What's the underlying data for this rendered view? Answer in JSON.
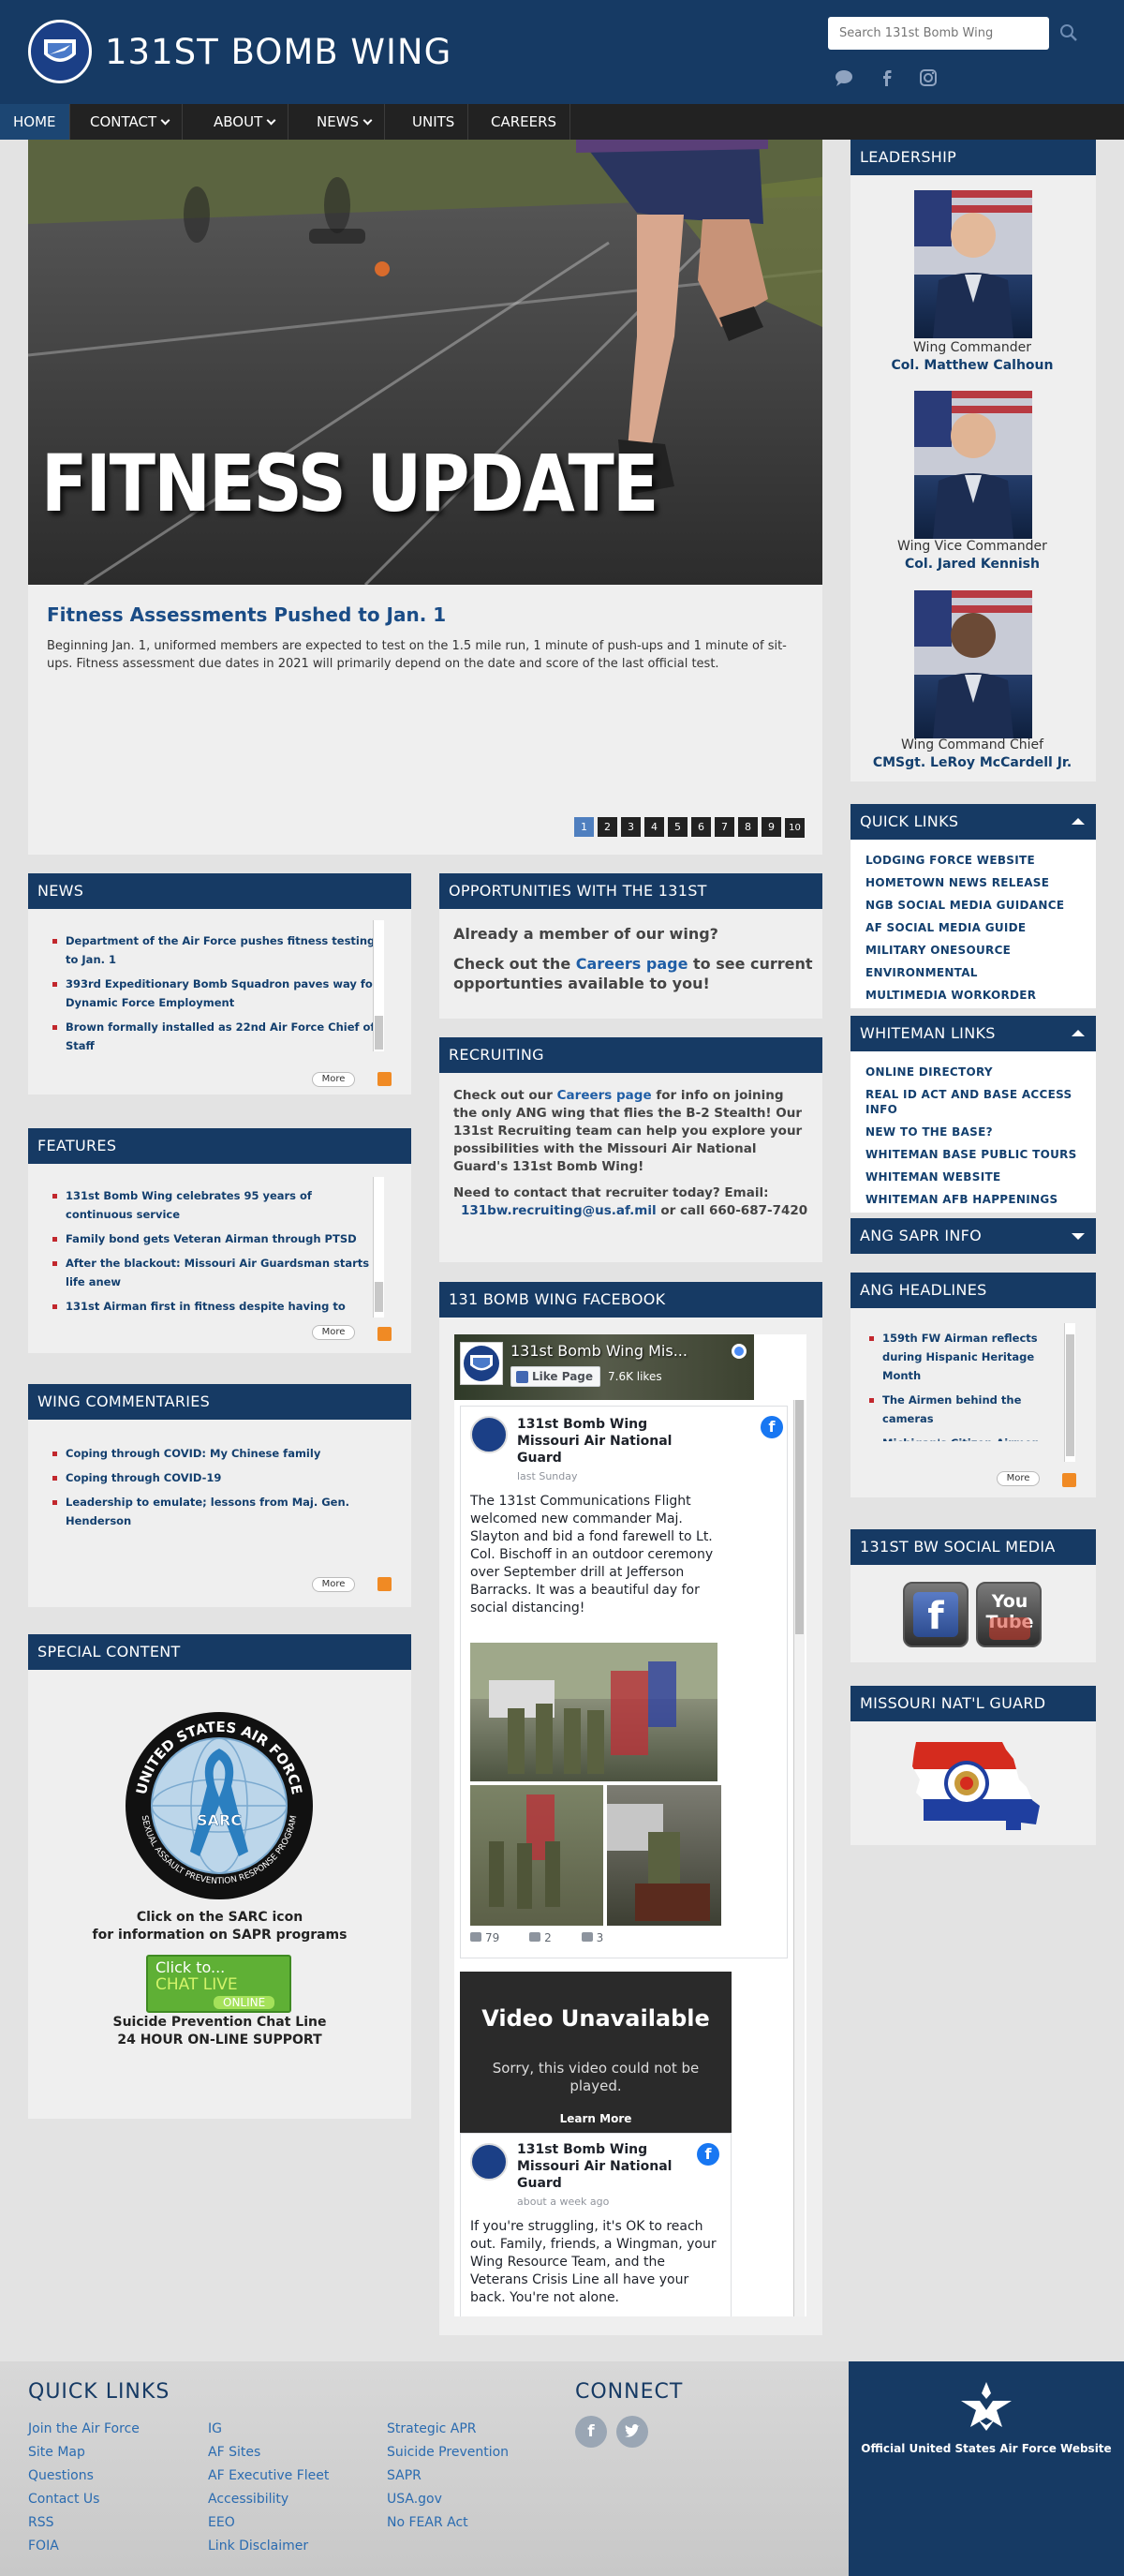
{
  "header": {
    "site_title": "131ST BOMB WING",
    "search_placeholder": "Search 131st Bomb Wing"
  },
  "nav": [
    {
      "label": "HOME",
      "active": true
    },
    {
      "label": "CONTACT",
      "dropdown": true
    },
    {
      "label": "ABOUT",
      "dropdown": true
    },
    {
      "label": "NEWS",
      "dropdown": true
    },
    {
      "label": "UNITS"
    },
    {
      "label": "CAREERS"
    }
  ],
  "hero": {
    "image_text": "FITNESS UPDATE",
    "headline": "Fitness Assessments Pushed to Jan. 1",
    "body": "Beginning Jan. 1, uniformed members are expected to test on the 1.5 mile run, 1 minute of push-ups and 1 minute of sit-ups. Fitness assessment due dates in 2021 will primarily depend on the date and score of the last official test.",
    "pages": [
      "1",
      "2",
      "3",
      "4",
      "5",
      "6",
      "7",
      "8",
      "9",
      "10"
    ],
    "current_page": 1
  },
  "news": {
    "title": "NEWS",
    "items": [
      "Department of the Air Force pushes fitness testing to Jan. 1",
      "393rd Expeditionary Bomb Squadron paves way for Dynamic Force Employment",
      "Brown formally installed as 22nd Air Force Chief of Staff"
    ],
    "more": "More"
  },
  "features": {
    "title": "FEATURES",
    "items": [
      "131st Bomb Wing celebrates 95 years of continuous service",
      "Family bond gets Veteran Airman through PTSD",
      "After the blackout: Missouri Air Guardsman starts life anew",
      "131st Airman first in fitness despite having to"
    ],
    "more": "More"
  },
  "commentaries": {
    "title": "WING COMMENTARIES",
    "items": [
      "Coping through COVID: My Chinese family",
      "Coping through COVID-19",
      "Leadership to emulate; lessons from Maj. Gen. Henderson"
    ],
    "more": "More"
  },
  "special": {
    "title": "SPECIAL CONTENT",
    "seal_top": "UNITED STATES AIR FORCE",
    "seal_mid": "SARC",
    "seal_bottom": "SEXUAL ASSAULT PREVENTION RESPONSE PROGRAM",
    "caption1": "Click on the SARC icon",
    "caption2": "for information on SAPR programs",
    "chat_click": "Click to...",
    "chat_live": "CHAT LIVE",
    "chat_online": "ONLINE",
    "chat_caption1": "Suicide Prevention Chat Line",
    "chat_caption2": "24 HOUR ON-LINE SUPPORT"
  },
  "opportunities": {
    "title": "OPPORTUNITIES WITH THE 131ST",
    "line1": "Already a member of our wing?",
    "line2_pre": "Check out the ",
    "line2_link": "Careers page",
    "line2_post": " to see current opportunties available to you!"
  },
  "recruiting": {
    "title": "RECRUITING",
    "p1_pre": "Check out our ",
    "p1_link": "Careers page",
    "p1_post": " for info on joining the only ANG wing that flies the B-2 Stealth!  Our 131st Recruiting team can help you explore your possibilities with the Missouri Air National Guard's 131st Bomb Wing!",
    "p2_pre": "Need to contact that recruiter today?  Email:",
    "p2_email": "131bw.recruiting@us.af.mil",
    "p2_post": "  or call 660-687-7420"
  },
  "facebook": {
    "title": "131 BOMB WING FACEBOOK",
    "page_name": "131st Bomb Wing Mis...",
    "like_label": "Like Page",
    "likes": "7.6K likes",
    "post1": {
      "author": "131st Bomb Wing Missouri Air National Guard",
      "time": "last Sunday",
      "text": "The 131st Communications Flight welcomed new commander Maj. Slayton and bid a fond farewell to Lt. Col. Bischoff in an outdoor ceremony over September drill at Jefferson Barracks. It was a beautiful day for social distancing!",
      "likes": "79",
      "comments": "2",
      "shares": "3"
    },
    "video": {
      "title": "Video Unavailable",
      "sub": "Sorry, this video could not be played.",
      "link": "Learn More"
    },
    "post2": {
      "author": "131st Bomb Wing Missouri Air National Guard",
      "time": "about a week ago",
      "text": "If you're struggling, it's OK to reach out. Family, friends, a Wingman, your Wing Resource Team, and the Veterans Crisis Line all have your back. You're not alone."
    }
  },
  "leadership": {
    "title": "LEADERSHIP",
    "people": [
      {
        "role": "Wing Commander",
        "name": "Col. Matthew Calhoun"
      },
      {
        "role": "Wing Vice Commander",
        "name": "Col. Jared Kennish"
      },
      {
        "role": "Wing Command Chief",
        "name": "CMSgt. LeRoy McCardell Jr."
      }
    ]
  },
  "quick_links": {
    "title": "QUICK LINKS",
    "items": [
      "LODGING FORCE WEBSITE",
      "HOMETOWN NEWS RELEASE",
      "NGB SOCIAL MEDIA GUIDANCE",
      "AF SOCIAL MEDIA GUIDE",
      "MILITARY ONESOURCE",
      "ENVIRONMENTAL",
      "MULTIMEDIA WORKORDER"
    ]
  },
  "whiteman_links": {
    "title": "WHITEMAN LINKS",
    "items": [
      "ONLINE DIRECTORY",
      "REAL ID ACT AND BASE ACCESS INFO",
      "NEW TO THE BASE?",
      "WHITEMAN BASE PUBLIC TOURS",
      "WHITEMAN WEBSITE",
      "WHITEMAN AFB HAPPENINGS"
    ]
  },
  "ang_sapr": {
    "title": "ANG SAPR INFO"
  },
  "ang_headlines": {
    "title": "ANG HEADLINES",
    "items": [
      "159th FW Airman reflects during Hispanic Heritage Month",
      "The Airmen behind the cameras",
      "Michigan's Citizen Airmen"
    ],
    "more": "More"
  },
  "social_media": {
    "title": "131ST BW SOCIAL MEDIA",
    "youtube_text": "You Tube"
  },
  "missouri": {
    "title": "MISSOURI NAT'L GUARD"
  },
  "footer": {
    "quick_links_title": "QUICK LINKS",
    "col1": [
      "Join the Air Force",
      "Site Map",
      "Questions",
      "Contact Us",
      "RSS",
      "FOIA"
    ],
    "col2": [
      "IG",
      "AF Sites",
      "AF Executive Fleet",
      "Accessibility",
      "EEO",
      "Link Disclaimer"
    ],
    "col3": [
      "Strategic APR",
      "Suicide Prevention",
      "SAPR",
      "USA.gov",
      "No FEAR Act"
    ],
    "connect_title": "CONNECT",
    "af_caption": "Official United States Air Force Website"
  },
  "colors": {
    "header_blue": "#163a64",
    "link_blue": "#133f6e",
    "bullet_red": "#c2272d",
    "nav_black": "#222222"
  }
}
